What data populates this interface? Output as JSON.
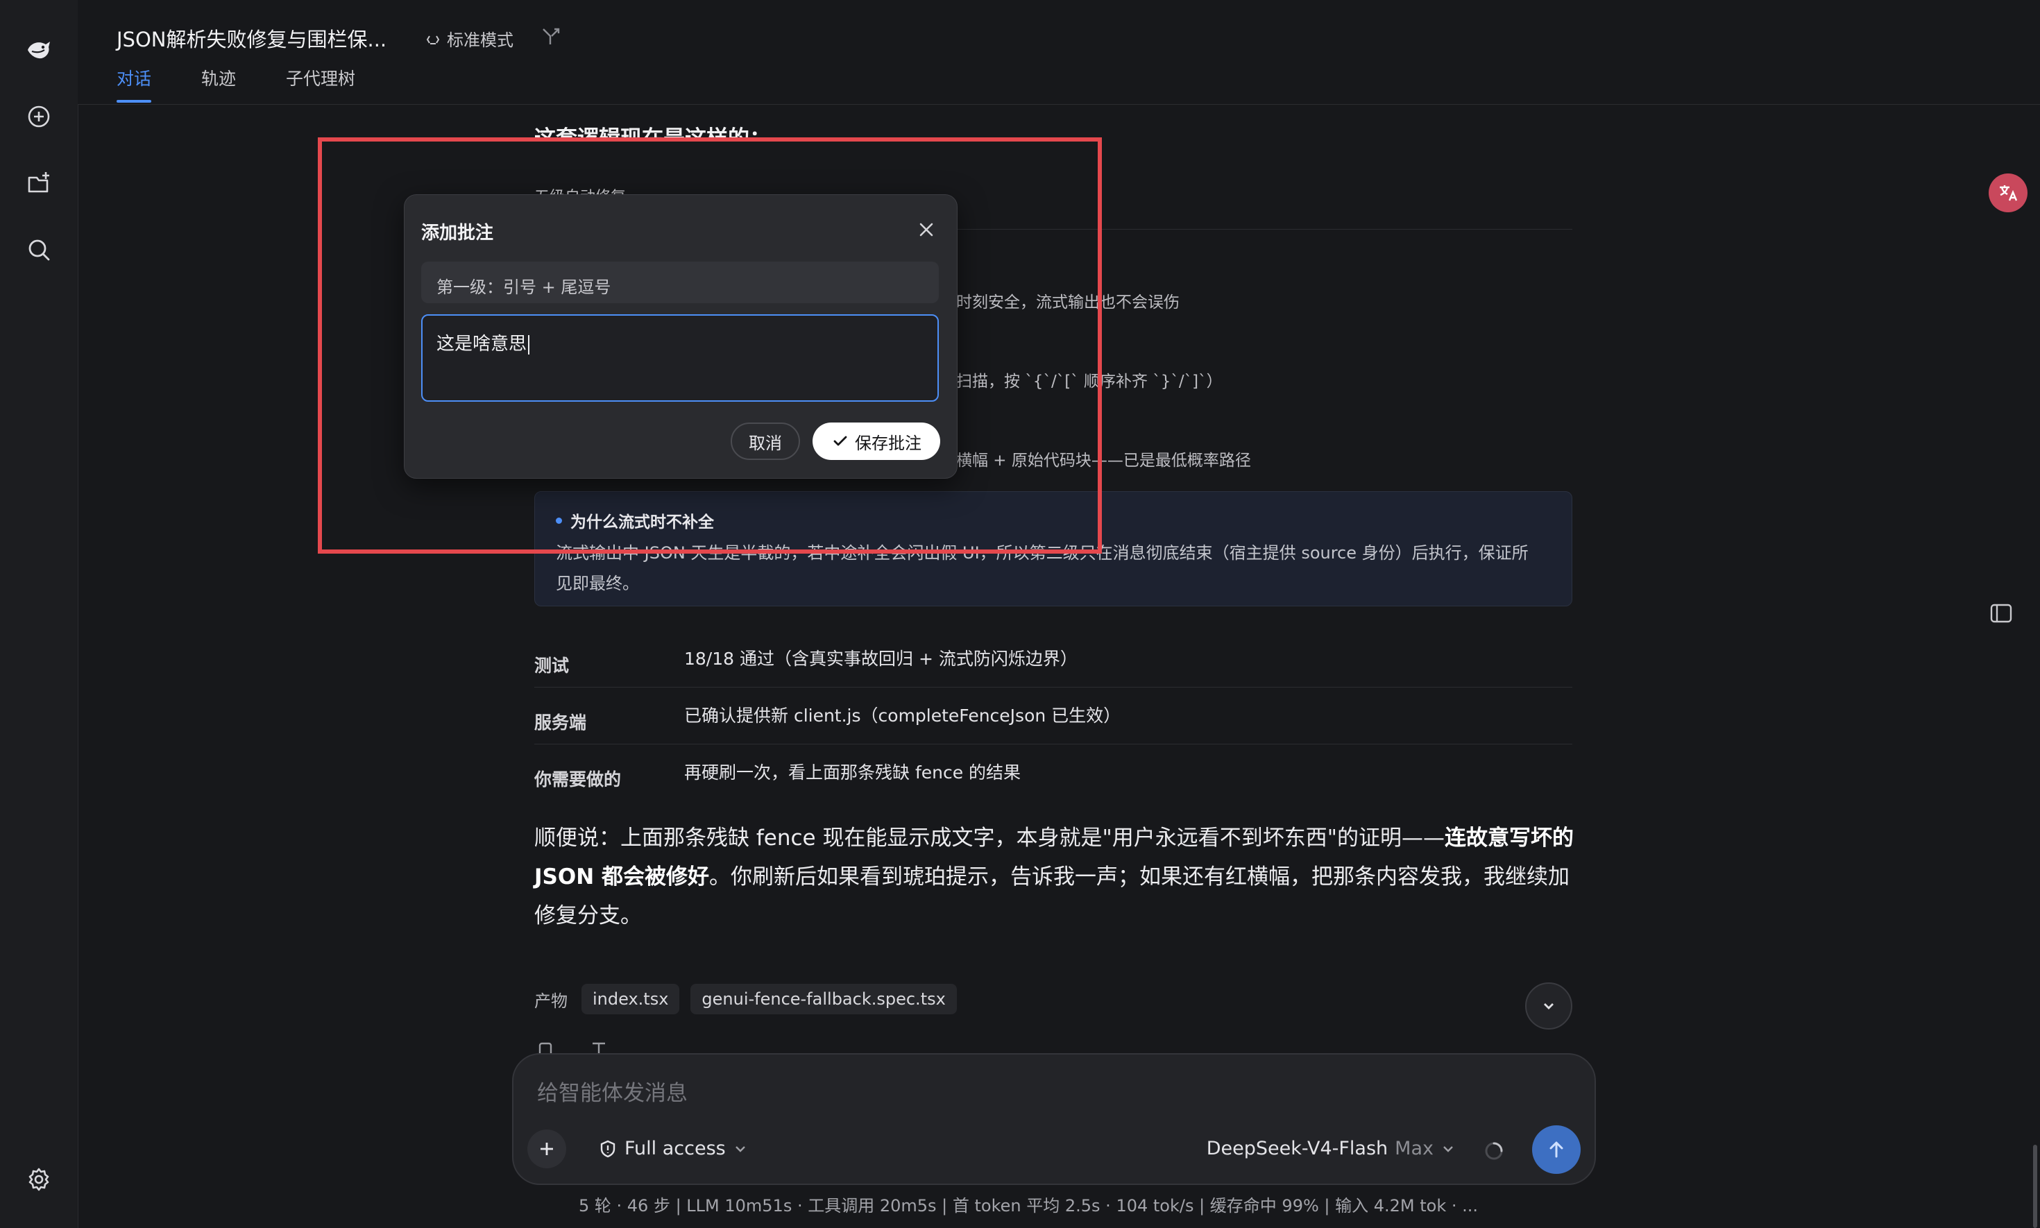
{
  "header": {
    "title": "JSON解析失败修复与围栏保...",
    "mode_label": "标准模式",
    "tabs": [
      {
        "label": "对话",
        "active": true
      },
      {
        "label": "轨迹",
        "active": false
      },
      {
        "label": "子代理树",
        "active": false
      }
    ]
  },
  "content": {
    "heading": "这套逻辑现在是这样的：",
    "subheading": "五级自动修复",
    "fragments": [
      "时刻安全，流式输出也不会误伤",
      "扫描，按 `{`/`[` 顺序补齐 `}`/`]`）",
      "横幅 + 原始代码块——已是最低概率路径"
    ],
    "callout": {
      "title": "为什么流式时不补全",
      "body": "流式输出中 JSON 天生是半截的，若中途补全会闪出假 UI，所以第二级只在消息彻底结束（宿主提供 source 身份）后执行，保证所见即最终。"
    },
    "table": [
      {
        "key": "测试",
        "value": "18/18 通过（含真实事故回归 + 流式防闪烁边界）"
      },
      {
        "key": "服务端",
        "value": "已确认提供新 client.js（completeFenceJson 已生效）"
      },
      {
        "key": "你需要做的",
        "value": "再硬刷一次，看上面那条残缺 fence 的结果"
      }
    ],
    "paragraph": {
      "part1": "顺便说：上面那条残缺 fence 现在能显示成文字，本身就是\"用户永远看不到坏东西\"的证明——",
      "bold": "连故意写坏的 JSON 都会被修好",
      "part2": "。你刷新后如果看到琥珀提示，告诉我一声；如果还有红横幅，把那条内容发我，我继续加修复分支。"
    },
    "artifacts_label": "产物",
    "artifacts": [
      "index.tsx",
      "genui-fence-fallback.spec.tsx"
    ]
  },
  "composer": {
    "placeholder": "给智能体发消息",
    "access_label": "Full access",
    "model_name": "DeepSeek-V4-Flash",
    "model_tier": "Max"
  },
  "status_bar": "5 轮 · 46 步   |   LLM 10m51s · 工具调用 20m5s   |   首 token 平均 2.5s · 104 tok/s   |   缓存命中 99%   |   输入 4.2M tok · ...",
  "dialog": {
    "title": "添加批注",
    "quote": "第一级：引号 + 尾逗号",
    "note_value": "这是啥意思",
    "cancel_label": "取消",
    "save_label": "保存批注"
  },
  "colors": {
    "accent": "#4d8ff7",
    "annotation_box": "#e5484d",
    "translate_badge": "#c9485c"
  },
  "icons": [
    "logo-icon",
    "new-chat-icon",
    "new-folder-icon",
    "search-icon",
    "settings-icon",
    "shield-icon",
    "translate-icon",
    "panel-toggle-icon",
    "close-icon",
    "check-icon",
    "send-icon",
    "chevron-down-icon",
    "plus-icon"
  ]
}
